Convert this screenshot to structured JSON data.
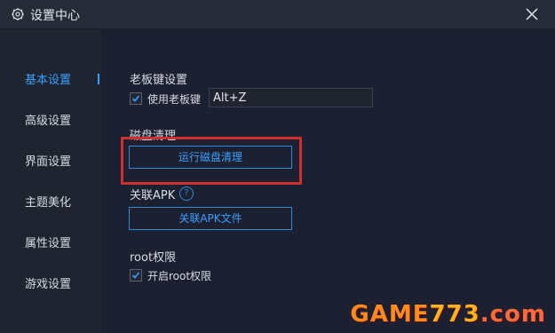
{
  "window": {
    "title": "设置中心"
  },
  "sidebar": {
    "items": [
      {
        "label": "基本设置",
        "active": true
      },
      {
        "label": "高级设置"
      },
      {
        "label": "界面设置"
      },
      {
        "label": "主题美化"
      },
      {
        "label": "属性设置"
      },
      {
        "label": "游戏设置"
      }
    ]
  },
  "settings": {
    "boss_key": {
      "title": "老板键设置",
      "checkbox_label": "使用老板键",
      "checked": true,
      "hotkey_value": "Alt+Z"
    },
    "disk_cleanup": {
      "title": "磁盘清理",
      "button_label": "运行磁盘清理"
    },
    "apk": {
      "title": "关联APK",
      "help_symbol": "?",
      "button_label": "关联APK文件"
    },
    "root": {
      "title": "root权限",
      "checkbox_label": "开启root权限",
      "checked": true
    }
  },
  "watermark": {
    "text": "GAME773.com"
  },
  "colors": {
    "accent": "#3aa0ff",
    "background": "#1c2030",
    "highlight": "#cc2f2f"
  }
}
